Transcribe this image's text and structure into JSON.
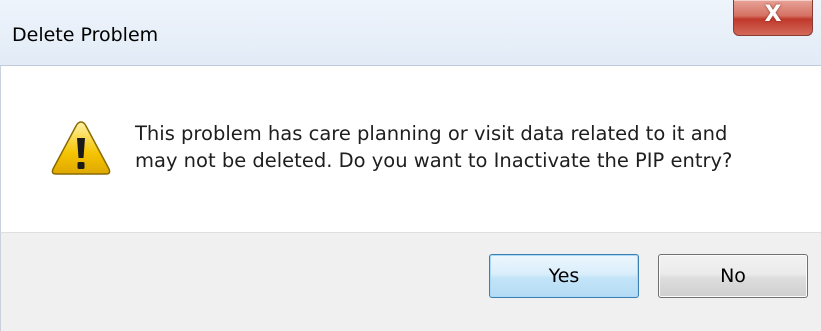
{
  "window": {
    "title": "Delete Problem",
    "close_label": "X"
  },
  "dialog": {
    "icon": "warning-triangle-icon",
    "message_lines": [
      "This problem has care planning or visit data related to it and",
      "may not be deleted.  Do you want to Inactivate the PIP entry?"
    ]
  },
  "buttons": {
    "yes_label": "Yes",
    "no_label": "No"
  },
  "colors": {
    "title_bar": "#e2ebf6",
    "close_button": "#c0392b",
    "footer": "#f0f0f0",
    "warning_fill": "#f5c400",
    "default_button_border": "#3c7fb1"
  }
}
